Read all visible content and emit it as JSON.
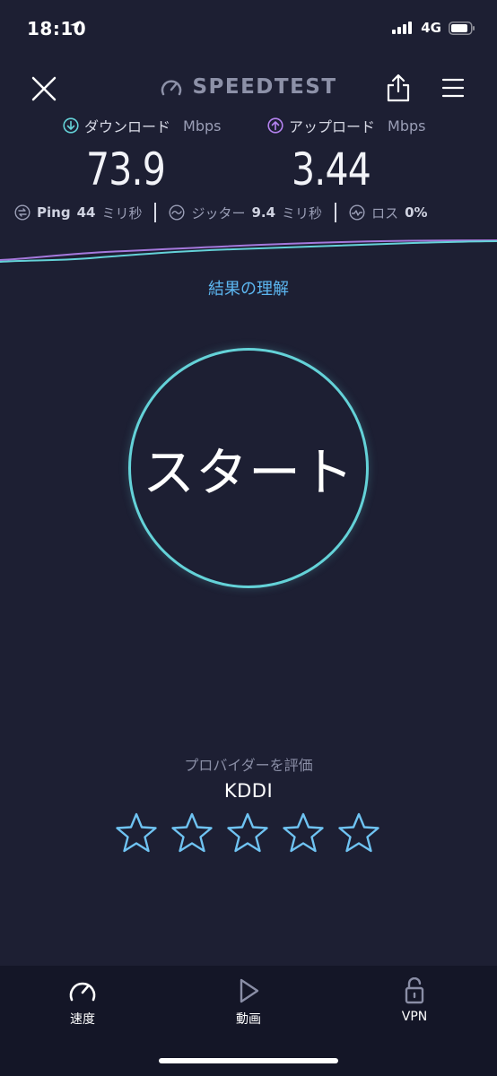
{
  "status_bar": {
    "time": "18:10",
    "network": "4G"
  },
  "header": {
    "logo": "SPEEDTEST"
  },
  "metrics": {
    "download": {
      "label": "ダウンロード",
      "unit": "Mbps",
      "value": "73.9"
    },
    "upload": {
      "label": "アップロード",
      "unit": "Mbps",
      "value": "3.44"
    }
  },
  "stats": {
    "ping": {
      "label": "Ping",
      "value": "44",
      "unit": "ミリ秒"
    },
    "jitter": {
      "label": "ジッター",
      "value": "9.4",
      "unit": "ミリ秒"
    },
    "loss": {
      "label": "ロス",
      "value": "0%"
    }
  },
  "results_link": "結果の理解",
  "start_label": "スタート",
  "rating": {
    "label": "プロバイダーを評価",
    "provider": "KDDI",
    "stars_total": 5,
    "stars_filled": 0
  },
  "tabs": [
    {
      "label": "速度",
      "icon": "speedometer-icon",
      "active": true
    },
    {
      "label": "動画",
      "icon": "play-icon",
      "active": false
    },
    {
      "label": "VPN",
      "icon": "lock-icon",
      "active": false
    }
  ],
  "colors": {
    "background": "#1d1f33",
    "download_accent": "#64d2d8",
    "upload_accent": "#b583f0",
    "link": "#5cb6f0"
  }
}
